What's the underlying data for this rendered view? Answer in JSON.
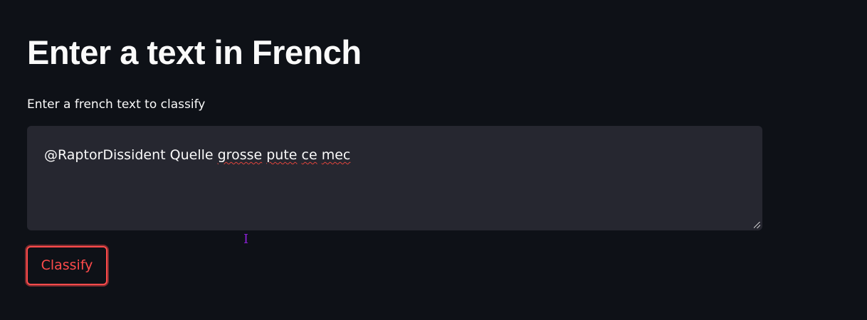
{
  "page": {
    "title": "Enter a text in French"
  },
  "form": {
    "label": "Enter a french text to classify",
    "input_text": {
      "part1": "@RaptorDissident Quelle ",
      "part2": "grosse",
      "part3": " ",
      "part4": "pute",
      "part5": " ",
      "part6": "ce",
      "part7": " ",
      "part8": "mec"
    },
    "classify_label": "Classify"
  },
  "colors": {
    "background": "#0e1117",
    "input_background": "#262730",
    "accent": "#ff4b4b",
    "text": "#fafafa",
    "spellcheck": "#e0443b"
  },
  "icons": {
    "cursor": "i-beam-cursor-icon",
    "resize": "resize-handle-icon"
  }
}
